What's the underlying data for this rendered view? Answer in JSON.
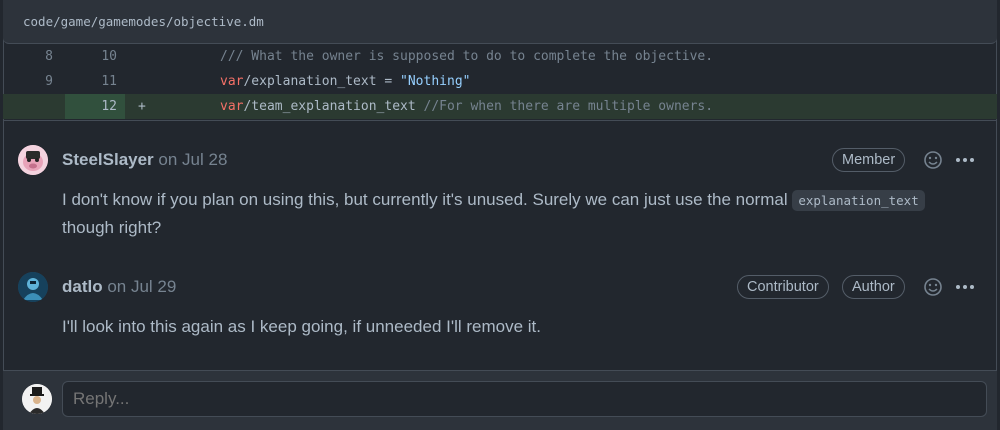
{
  "file": {
    "path": "code/game/gamemodes/objective.dm"
  },
  "diff": {
    "lines": [
      {
        "old": "8",
        "new": "10",
        "marker": "",
        "type": "context",
        "segments": [
          {
            "text": "/// What the owner is supposed to do to complete the objective.",
            "cls": "cm"
          }
        ]
      },
      {
        "old": "9",
        "new": "11",
        "marker": "",
        "type": "context",
        "segments": [
          {
            "text": "var",
            "cls": "kw"
          },
          {
            "text": "/explanation_text = ",
            "cls": ""
          },
          {
            "text": "\"Nothing\"",
            "cls": "str"
          }
        ]
      },
      {
        "old": "",
        "new": "12",
        "marker": "+",
        "type": "added",
        "segments": [
          {
            "text": "var",
            "cls": "kw"
          },
          {
            "text": "/team_explanation_text ",
            "cls": ""
          },
          {
            "text": "//For when there are multiple owners.",
            "cls": "cm"
          }
        ]
      }
    ]
  },
  "comments": [
    {
      "author": "SteelSlayer",
      "date": "on Jul 28",
      "badges": [
        "Member"
      ],
      "body_before": "I don't know if you plan on using this, but currently it's unused. Surely we can just use the normal ",
      "body_code": "explanation_text",
      "body_after": " though right?"
    },
    {
      "author": "datlo",
      "date": "on Jul 29",
      "badges": [
        "Contributor",
        "Author"
      ],
      "body_before": "I'll look into this again as I keep going, if unneeded I'll remove it.",
      "body_code": "",
      "body_after": ""
    }
  ],
  "reply": {
    "placeholder": "Reply..."
  },
  "icons": {
    "reaction": "smiley-icon",
    "menu": "kebab-horizontal-icon"
  },
  "colors": {
    "background": "#22272e",
    "added_line": "#2b3a31",
    "keyword": "#f47067",
    "string": "#96d0ff",
    "comment": "#768390"
  }
}
